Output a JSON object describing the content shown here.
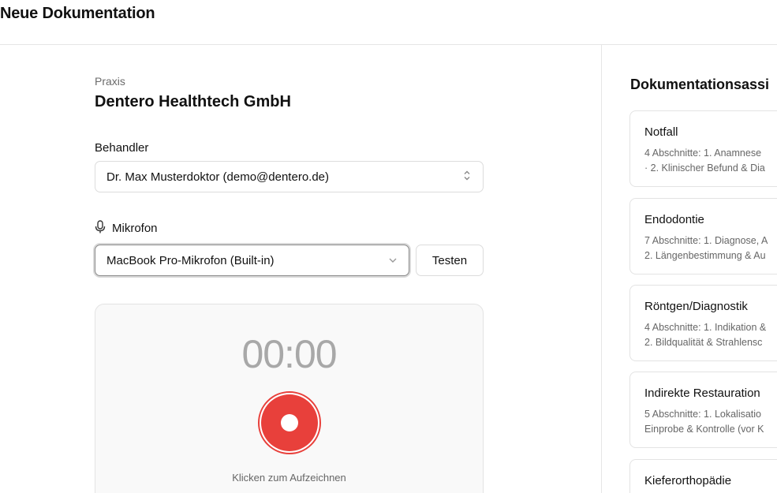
{
  "header": {
    "title": "Neue Dokumentation"
  },
  "praxis": {
    "label": "Praxis",
    "name": "Dentero Healthtech GmbH"
  },
  "behandler": {
    "label": "Behandler",
    "selected": "Dr. Max Musterdoktor (demo@dentero.de)"
  },
  "mikrofon": {
    "label": "Mikrofon",
    "selected": "MacBook Pro-Mikrofon (Built-in)",
    "test_label": "Testen"
  },
  "recorder": {
    "timer": "00:00",
    "hint": "Klicken zum Aufzeichnen",
    "color": "#e8403b"
  },
  "assistant": {
    "title": "Dokumentationsassi",
    "templates": [
      {
        "title": "Notfall",
        "line1": "4 Abschnitte: 1. Anamnese",
        "line2": "· 2. Klinischer Befund & Dia"
      },
      {
        "title": "Endodontie",
        "line1": "7 Abschnitte: 1. Diagnose, A",
        "line2": "2. Längenbestimmung & Au"
      },
      {
        "title": "Röntgen/Diagnostik",
        "line1": "4 Abschnitte: 1. Indikation &",
        "line2": "2. Bildqualität & Strahlensc"
      },
      {
        "title": "Indirekte Restauration",
        "line1": "5 Abschnitte: 1. Lokalisatio",
        "line2": "Einprobe & Kontrolle (vor K"
      },
      {
        "title": "Kieferorthopädie",
        "line1": "",
        "line2": ""
      }
    ]
  }
}
